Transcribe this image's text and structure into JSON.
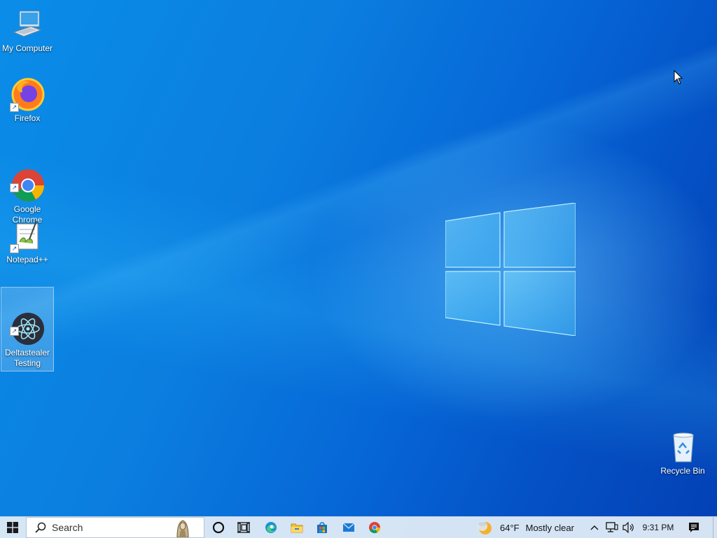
{
  "desktop": {
    "icons": [
      {
        "label": "My Computer"
      },
      {
        "label": "Firefox"
      },
      {
        "label": "Google\nChrome"
      },
      {
        "label": "Notepad++"
      },
      {
        "label": "Deltastealer\nTesting"
      },
      {
        "label": "Recycle Bin"
      }
    ]
  },
  "taskbar": {
    "search": {
      "placeholder": "Search",
      "value": ""
    },
    "weather": {
      "temperature": "64°F",
      "condition": "Mostly clear"
    },
    "clock": {
      "time": "9:31 PM"
    },
    "pinned": [
      "cortana-icon",
      "task-view-icon",
      "edge-icon",
      "file-explorer-icon",
      "store-icon",
      "mail-icon",
      "chrome-icon"
    ]
  },
  "colors": {
    "desktop_blue": "#0b7ee0",
    "taskbar_bg": "#deeaf6",
    "selection": "#96c8f0"
  }
}
